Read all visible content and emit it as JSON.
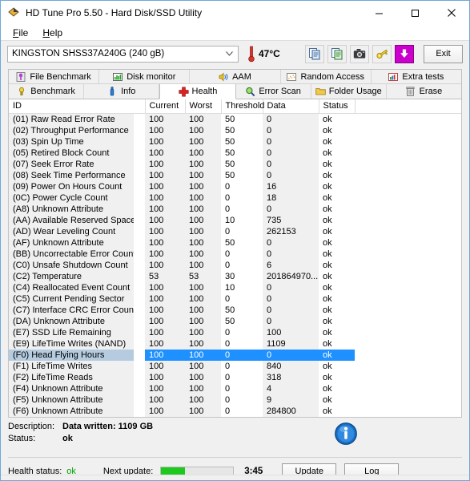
{
  "window": {
    "title": "HD Tune Pro 5.50 - Hard Disk/SSD Utility",
    "icon": "hdtune-app-icon",
    "minimize": "─",
    "maximize": "☐",
    "close": "✕"
  },
  "menu": [
    {
      "label": "File",
      "mnemonic": "F"
    },
    {
      "label": "Help",
      "mnemonic": "H"
    }
  ],
  "toolbar": {
    "drive_selected": "KINGSTON SHSS37A240G (240 gB)",
    "drive_chevron": "∨",
    "temperature": "47°C",
    "thermometer_icon": "thermometer-icon",
    "buttons": [
      {
        "name": "copy-icon",
        "label": ""
      },
      {
        "name": "copy-sheet-icon",
        "label": ""
      },
      {
        "name": "camera-icon",
        "label": ""
      },
      {
        "name": "key-icon",
        "label": ""
      },
      {
        "name": "download-icon",
        "label": ""
      }
    ],
    "exit_label": "Exit"
  },
  "tabs": {
    "row1": [
      {
        "label": "File Benchmark",
        "icon": "file-benchmark-icon",
        "active": false
      },
      {
        "label": "Disk monitor",
        "icon": "disk-monitor-icon",
        "active": false
      },
      {
        "label": "AAM",
        "icon": "speaker-icon",
        "active": false
      },
      {
        "label": "Random Access",
        "icon": "random-access-icon",
        "active": false
      },
      {
        "label": "Extra tests",
        "icon": "extra-tests-icon",
        "active": false
      }
    ],
    "row2": [
      {
        "label": "Benchmark",
        "icon": "benchmark-icon",
        "active": false
      },
      {
        "label": "Info",
        "icon": "info-tab-icon",
        "active": false
      },
      {
        "label": "Health",
        "icon": "health-cross-icon",
        "active": true
      },
      {
        "label": "Error Scan",
        "icon": "magnifier-icon",
        "active": false
      },
      {
        "label": "Folder Usage",
        "icon": "folder-icon",
        "active": false
      },
      {
        "label": "Erase",
        "icon": "trash-icon",
        "active": false
      }
    ]
  },
  "table": {
    "columns": [
      "ID",
      "Current",
      "Worst",
      "Threshold",
      "Data",
      "Status",
      ""
    ],
    "selected_index": 21,
    "rows": [
      {
        "id": "(01) Raw Read Error Rate",
        "current": "100",
        "worst": "100",
        "threshold": "50",
        "data": "0",
        "status": "ok"
      },
      {
        "id": "(02) Throughput Performance",
        "current": "100",
        "worst": "100",
        "threshold": "50",
        "data": "0",
        "status": "ok"
      },
      {
        "id": "(03) Spin Up Time",
        "current": "100",
        "worst": "100",
        "threshold": "50",
        "data": "0",
        "status": "ok"
      },
      {
        "id": "(05) Retired Block Count",
        "current": "100",
        "worst": "100",
        "threshold": "50",
        "data": "0",
        "status": "ok"
      },
      {
        "id": "(07) Seek Error Rate",
        "current": "100",
        "worst": "100",
        "threshold": "50",
        "data": "0",
        "status": "ok"
      },
      {
        "id": "(08) Seek Time Performance",
        "current": "100",
        "worst": "100",
        "threshold": "50",
        "data": "0",
        "status": "ok"
      },
      {
        "id": "(09) Power On Hours Count",
        "current": "100",
        "worst": "100",
        "threshold": "0",
        "data": "16",
        "status": "ok"
      },
      {
        "id": "(0C) Power Cycle Count",
        "current": "100",
        "worst": "100",
        "threshold": "0",
        "data": "18",
        "status": "ok"
      },
      {
        "id": "(A8) Unknown Attribute",
        "current": "100",
        "worst": "100",
        "threshold": "0",
        "data": "0",
        "status": "ok"
      },
      {
        "id": "(AA) Available Reserved Space",
        "current": "100",
        "worst": "100",
        "threshold": "10",
        "data": "735",
        "status": "ok"
      },
      {
        "id": "(AD) Wear Leveling Count",
        "current": "100",
        "worst": "100",
        "threshold": "0",
        "data": "262153",
        "status": "ok"
      },
      {
        "id": "(AF) Unknown Attribute",
        "current": "100",
        "worst": "100",
        "threshold": "50",
        "data": "0",
        "status": "ok"
      },
      {
        "id": "(BB) Uncorrectable Error Count",
        "current": "100",
        "worst": "100",
        "threshold": "0",
        "data": "0",
        "status": "ok"
      },
      {
        "id": "(C0) Unsafe Shutdown Count",
        "current": "100",
        "worst": "100",
        "threshold": "0",
        "data": "6",
        "status": "ok"
      },
      {
        "id": "(C2) Temperature",
        "current": "53",
        "worst": "53",
        "threshold": "30",
        "data": "201864970...",
        "status": "ok"
      },
      {
        "id": "(C4) Reallocated Event Count",
        "current": "100",
        "worst": "100",
        "threshold": "10",
        "data": "0",
        "status": "ok"
      },
      {
        "id": "(C5) Current Pending Sector",
        "current": "100",
        "worst": "100",
        "threshold": "0",
        "data": "0",
        "status": "ok"
      },
      {
        "id": "(C7) Interface CRC Error Count",
        "current": "100",
        "worst": "100",
        "threshold": "50",
        "data": "0",
        "status": "ok"
      },
      {
        "id": "(DA) Unknown Attribute",
        "current": "100",
        "worst": "100",
        "threshold": "50",
        "data": "0",
        "status": "ok"
      },
      {
        "id": "(E7) SSD Life Remaining",
        "current": "100",
        "worst": "100",
        "threshold": "0",
        "data": "100",
        "status": "ok"
      },
      {
        "id": "(E9) LifeTime Writes (NAND)",
        "current": "100",
        "worst": "100",
        "threshold": "0",
        "data": "1109",
        "status": "ok"
      },
      {
        "id": "(F0) Head Flying Hours",
        "current": "100",
        "worst": "100",
        "threshold": "0",
        "data": "0",
        "status": "ok"
      },
      {
        "id": "(F1) LifeTime Writes",
        "current": "100",
        "worst": "100",
        "threshold": "0",
        "data": "840",
        "status": "ok"
      },
      {
        "id": "(F2) LifeTime Reads",
        "current": "100",
        "worst": "100",
        "threshold": "0",
        "data": "318",
        "status": "ok"
      },
      {
        "id": "(F4) Unknown Attribute",
        "current": "100",
        "worst": "100",
        "threshold": "0",
        "data": "4",
        "status": "ok"
      },
      {
        "id": "(F5) Unknown Attribute",
        "current": "100",
        "worst": "100",
        "threshold": "0",
        "data": "9",
        "status": "ok"
      },
      {
        "id": "(F6) Unknown Attribute",
        "current": "100",
        "worst": "100",
        "threshold": "0",
        "data": "284800",
        "status": "ok"
      }
    ]
  },
  "details": {
    "description_label": "Description:",
    "description_value": "Data written: 1109 GB",
    "status_label": "Status:",
    "status_value": "ok",
    "info_icon": "info-circle-icon"
  },
  "statusbar": {
    "health_label": "Health status:",
    "health_value": "ok",
    "next_update_label": "Next update:",
    "progress_percent": 33,
    "timer": "3:45",
    "update_label": "Update",
    "log_label": "Log"
  },
  "colors": {
    "selection_blue": "#1e90ff",
    "selection_id": "#b4cbe0",
    "progress_green": "#1ec81e",
    "ok_green": "#00a000",
    "window_border": "#6fa8d6"
  }
}
